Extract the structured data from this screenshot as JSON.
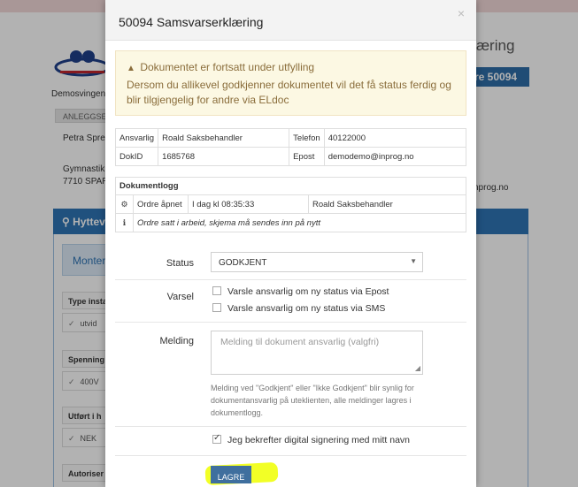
{
  "background": {
    "title_fragment": "rklæring",
    "badge": "re 50094",
    "company": "Demosvingen",
    "section_head": "ANLEGGSEI",
    "person": "Petra Spre",
    "address_line1": "Gymnastik",
    "address_line2": "7710 SPAR",
    "email_fragment": "nprog.no",
    "panel_head": "Hyttev",
    "panel_sub": "Monter",
    "rows": [
      {
        "label": "Type insta",
        "value": "utvid"
      },
      {
        "label": "Spenning",
        "value": "400V"
      },
      {
        "label": "Utført i h",
        "value": "NEK"
      },
      {
        "label": "Autoriser"
      }
    ]
  },
  "modal": {
    "title": "50094 Samsvarserklæring",
    "close": "×",
    "warning": {
      "title": "Dokumentet er fortsatt under utfylling",
      "text": "Dersom du allikevel godkjenner dokumentet vil det få status ferdig og blir tilgjengelig for andre via ELdoc"
    },
    "info": {
      "ansvarlig_label": "Ansvarlig",
      "ansvarlig_value": "Roald Saksbehandler",
      "telefon_label": "Telefon",
      "telefon_value": "40122000",
      "dokid_label": "DokID",
      "dokid_value": "1685768",
      "epost_label": "Epost",
      "epost_value": "demodemo@inprog.no"
    },
    "log": {
      "title": "Dokumentlogg",
      "entry_action": "Ordre åpnet",
      "entry_time": "I dag kl 08:35:33",
      "entry_user": "Roald Saksbehandler",
      "note": "Ordre satt i arbeid, skjema må sendes inn på nytt"
    },
    "form": {
      "status_label": "Status",
      "status_value": "GODKJENT",
      "varsel_label": "Varsel",
      "varsel_epost": "Varsle ansvarlig om ny status via Epost",
      "varsel_sms": "Varsle ansvarlig om ny status via SMS",
      "melding_label": "Melding",
      "melding_placeholder": "Melding til dokument ansvarlig (valgfri)",
      "help_text": "Melding ved \"Godkjent\" eller \"Ikke Godkjent\" blir synlig for dokumentansvarlig på uteklienten, alle meldinger lagres i dokumentlogg.",
      "confirm_text": "Jeg bekrefter digital signering med mitt navn",
      "confirm_checked": true,
      "save_label": "LAGRE"
    }
  },
  "colors": {
    "highlight": "#f0ff00",
    "primary": "#2f74b5",
    "warning_bg": "#fcf8e3"
  }
}
